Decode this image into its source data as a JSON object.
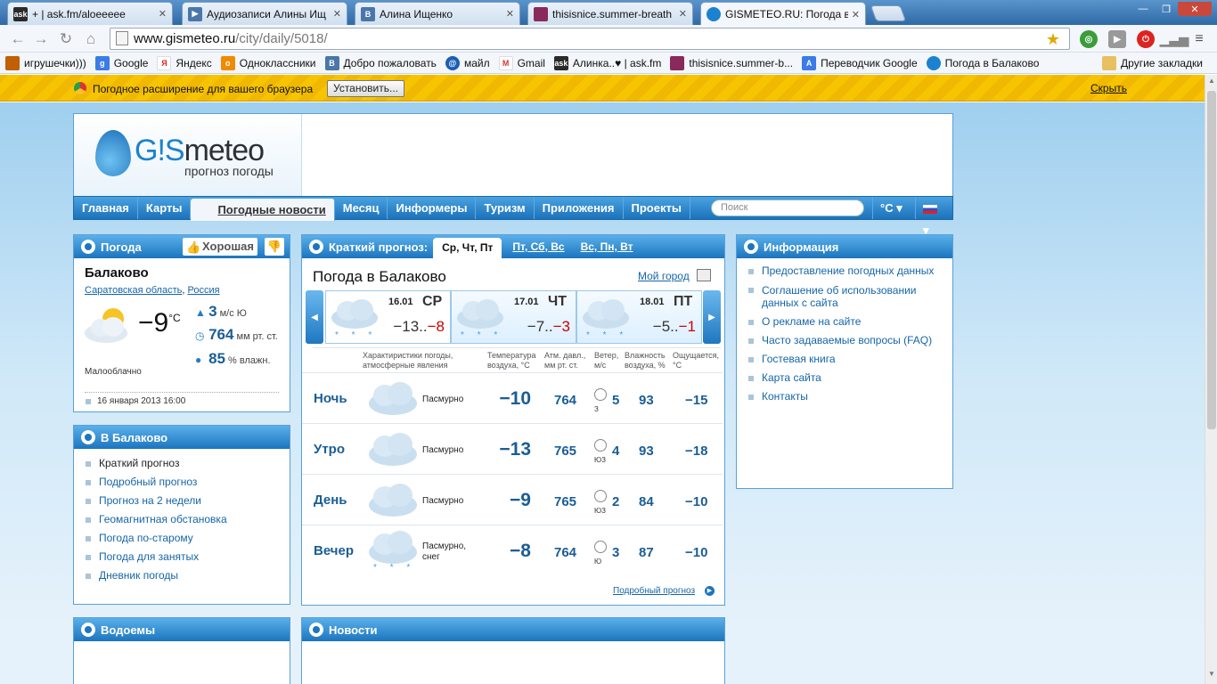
{
  "browser": {
    "tabs": [
      {
        "title": "+ | ask.fm/aloeeeee",
        "icon": "ask",
        "color": "#2a2a2a"
      },
      {
        "title": "Аудиозаписи Алины Ищ",
        "icon": "play",
        "color": "#4a76a8"
      },
      {
        "title": "Алина Ищенко",
        "icon": "vk",
        "color": "#4a76a8"
      },
      {
        "title": "thisisnice.summer-breath",
        "icon": "img",
        "color": "#8a2a5a"
      },
      {
        "title": "GISMETEO.RU: Погода в Б",
        "icon": "drop",
        "color": "#1a82cf"
      }
    ],
    "url_host": "www.gismeteo.ru",
    "url_path": "/city/daily/5018/",
    "bookmarks": [
      {
        "label": "игрушечки)))",
        "color": "#c06000"
      },
      {
        "label": "Google",
        "color": "#3b7be8"
      },
      {
        "label": "Яндекс",
        "color": "#e02020"
      },
      {
        "label": "Одноклассники",
        "color": "#f08a00"
      },
      {
        "label": "Добро пожаловать",
        "color": "#4a76a8"
      },
      {
        "label": "майл",
        "color": "#1a5fb4"
      },
      {
        "label": "Gmail",
        "color": "#d33"
      },
      {
        "label": "Алинка..♥ | ask.fm",
        "color": "#2a2a2a"
      },
      {
        "label": "thisisnice.summer-b...",
        "color": "#8a2a5a"
      },
      {
        "label": "Переводчик Google",
        "color": "#3b7be8"
      },
      {
        "label": "Погода в Балаково",
        "color": "#1a82cf"
      }
    ],
    "other_bookmarks": "Другие закладки",
    "infobar": {
      "message": "Погодное расширение для вашего браузера",
      "install": "Установить...",
      "hide": "Скрыть"
    }
  },
  "site": {
    "logo_text_a": "G!S",
    "logo_text_b": "meteo",
    "logo_sub": "прогноз погоды",
    "nav": [
      "Главная",
      "Карты",
      "Погодные новости",
      "Месяц",
      "Информеры",
      "Туризм",
      "Приложения",
      "Проекты"
    ],
    "search_placeholder": "Поиск",
    "units": "°C ▾",
    "lang": "▾"
  },
  "weather": {
    "title": "Погода",
    "rating": "Хорошая",
    "city": "Балаково",
    "region": "Саратовская область",
    "country": "Россия",
    "sep": ",",
    "temp": "−9",
    "deg": "°C",
    "wind_val": "3",
    "wind_unit": "м/с  Ю",
    "pressure_val": "764",
    "pressure_unit": "мм рт. ст.",
    "humidity_val": "85",
    "humidity_unit": "% влажн.",
    "condition": "Малооблачно",
    "datetime": "16 января 2013 16:00"
  },
  "city_menu": {
    "title": "В Балаково",
    "items": [
      "Краткий прогноз",
      "Подробный прогноз",
      "Прогноз на 2 недели",
      "Геомагнитная обстановка",
      "Погода по-старому",
      "Погода для занятых",
      "Дневник погоды"
    ]
  },
  "forecast": {
    "title": "Краткий прогноз:",
    "tabs": [
      "Ср, Чт, Пт",
      "Пт, Сб, Вс",
      "Вс, Пн, Вт"
    ],
    "heading": "Погода в Балаково",
    "my_city": "Мой город",
    "days": [
      {
        "date": "16.01",
        "name": "СР",
        "lo": "−13..",
        "hi": "−8"
      },
      {
        "date": "17.01",
        "name": "ЧТ",
        "lo": "−7..",
        "hi": "−3"
      },
      {
        "date": "18.01",
        "name": "ПТ",
        "lo": "−5..",
        "hi": "−1"
      }
    ],
    "snow": "* * *",
    "columns": [
      "Характиристики погоды, атмосферные явления",
      "Температура воздуха, °C",
      "Атм. давл., мм рт. ст.",
      "Ветер, м/с",
      "Влажность воздуха, %",
      "Ощущается, °C"
    ],
    "rows": [
      {
        "part": "Ночь",
        "cond": "Пасмурно",
        "temp": "−10",
        "press": "764",
        "wind": "5",
        "dir": "З",
        "hum": "93",
        "feel": "−15"
      },
      {
        "part": "Утро",
        "cond": "Пасмурно",
        "temp": "−13",
        "press": "765",
        "wind": "4",
        "dir": "ЮЗ",
        "hum": "93",
        "feel": "−18"
      },
      {
        "part": "День",
        "cond": "Пасмурно",
        "temp": "−9",
        "press": "765",
        "wind": "2",
        "dir": "ЮЗ",
        "hum": "84",
        "feel": "−10"
      },
      {
        "part": "Вечер",
        "cond": "Пасмурно, снег",
        "temp": "−8",
        "press": "764",
        "wind": "3",
        "dir": "Ю",
        "hum": "87",
        "feel": "−10"
      }
    ],
    "detail_link": "Подробный прогноз"
  },
  "info": {
    "title": "Информация",
    "items": [
      "Предоставление погодных данных",
      "Соглашение об использовании данных с сайта",
      "О рекламе на сайте",
      "Часто задаваемые вопросы (FAQ)",
      "Гостевая книга",
      "Карта сайта",
      "Контакты"
    ]
  },
  "bottom": {
    "water": "Водоемы",
    "news": "Новости"
  }
}
